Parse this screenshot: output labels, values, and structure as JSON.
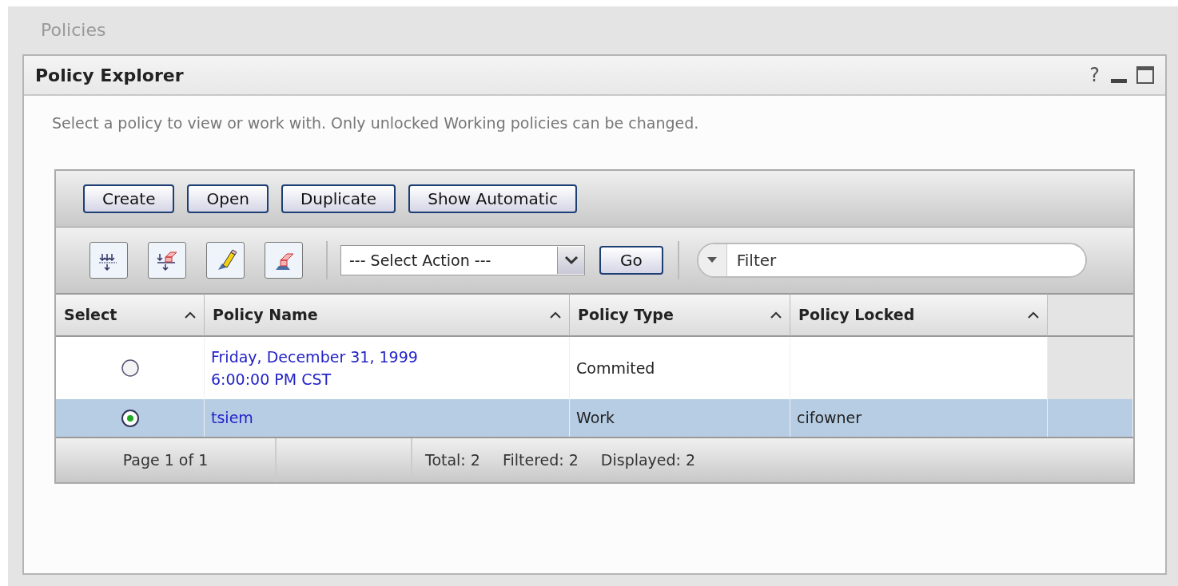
{
  "page_title": "Policies",
  "panel": {
    "title": "Policy Explorer",
    "help": "?"
  },
  "description": "Select a policy to view or work with. Only unlocked Working policies can be changed.",
  "buttons": [
    "Create",
    "Open",
    "Duplicate",
    "Show Automatic"
  ],
  "action_select": {
    "value": "--- Select Action ---"
  },
  "go_button": "Go",
  "filter": {
    "placeholder": "Filter"
  },
  "table": {
    "columns": [
      "Select",
      "Policy Name",
      "Policy Type",
      "Policy Locked"
    ],
    "rows": [
      {
        "selected": false,
        "name": "Friday, December 31, 1999 6:00:00 PM CST",
        "type": "Commited",
        "locked": ""
      },
      {
        "selected": true,
        "name": "tsiem",
        "type": "Work",
        "locked": "cifowner"
      }
    ]
  },
  "footer": {
    "page": "Page 1 of 1",
    "stats": [
      "Total: 2",
      "Filtered: 2",
      "Displayed: 2"
    ]
  }
}
